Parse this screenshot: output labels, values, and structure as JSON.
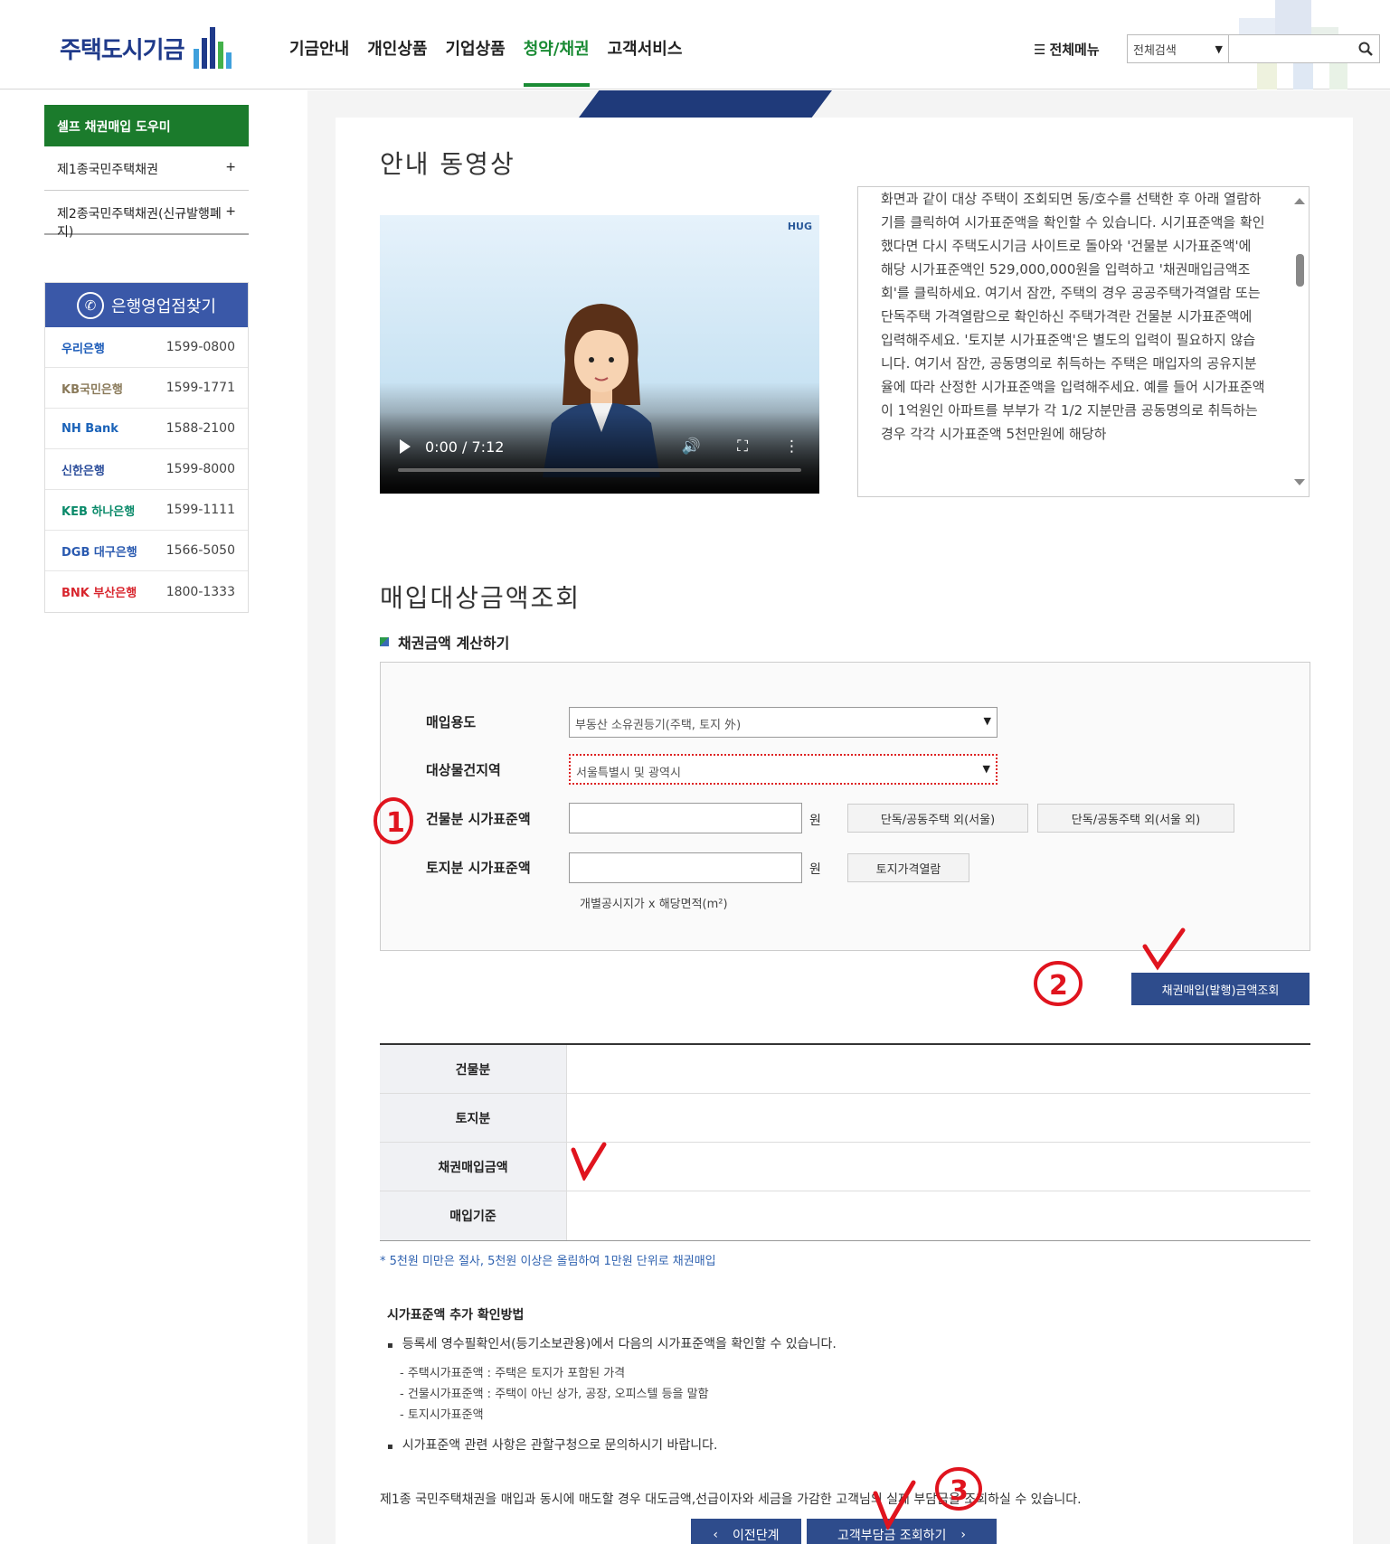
{
  "header": {
    "logo": "주택도시기금",
    "nav": [
      "기금안내",
      "개인상품",
      "기업상품",
      "청약/채권",
      "고객서비스"
    ],
    "active_nav": "청약/채권",
    "all_menu": "전체메뉴",
    "search_select": "전체검색"
  },
  "sidebar": {
    "active": "셀프 채권매입 도우미",
    "items": [
      "제1종국민주택채권",
      "제2종국민주택채권(신규발행폐지)"
    ],
    "plus": "+",
    "bank_header": "은행영업점찾기",
    "banks": [
      {
        "name": "우리은행",
        "phone": "1599-0800",
        "color": "#1a5ab8"
      },
      {
        "name": "KB국민은행",
        "phone": "1599-1771",
        "color": "#8a7a5a"
      },
      {
        "name": "NH Bank",
        "phone": "1588-2100",
        "color": "#1a62b8"
      },
      {
        "name": "신한은행",
        "phone": "1599-8000",
        "color": "#2a4c9a"
      },
      {
        "name": "KEB 하나은행",
        "phone": "1599-1111",
        "color": "#0a8a6a"
      },
      {
        "name": "DGB 대구은행",
        "phone": "1566-5050",
        "color": "#2a5ab0"
      },
      {
        "name": "BNK 부산은행",
        "phone": "1800-1333",
        "color": "#d8262e"
      }
    ]
  },
  "video_section": {
    "title": "안내 동영상",
    "video_logo": "HUG",
    "time": "0:00 / 7:12",
    "description": "화면과 같이 대상 주택이 조회되면 동/호수를 선택한 후 아래 열람하기를 클릭하여 시가표준액을 확인할 수 있습니다. 시기표준액을 확인했다면 다시 주택도시기금 사이트로 돌아와 '건물분 시가표준액'에 해당 시가표준액인 529,000,000원을 입력하고 '채권매입금액조회'를 클릭하세요. 여기서 잠깐, 주택의 경우 공공주택가격열람 또는 단독주택 가격열람으로 확인하신 주택가격란 건물분 시가표준액에 입력해주세요. '토지분 시가표준액'은 별도의 입력이 필요하지 않습니다. 여기서 잠깐, 공동명의로 취득하는 주택은 매입자의 공유지분율에 따라 산정한 시가표준액을 입력해주세요. 예를 들어 시가표준액이 1억원인 아파트를 부부가 각 1/2 지분만큼 공동명의로 취득하는 경우 각각 시가표준액 5천만원에 해당하"
  },
  "calc_section": {
    "title": "매입대상금액조회",
    "subtitle": "채권금액 계산하기",
    "labels": {
      "purpose": "매입용도",
      "region": "대상물건지역",
      "building": "건물분 시가표준액",
      "land": "토지분 시가표준액"
    },
    "purpose_value": "부동산 소유권등기(주택, 토지 外)",
    "region_value": "서울특별시 및 광역시",
    "unit": "원",
    "buttons": {
      "seoul": "단독/공동주택 외(서울)",
      "non_seoul": "단독/공동주택 외(서울 외)",
      "land_price": "토지가격열람"
    },
    "hint": "개별공시지가 x 해당면적(m²)",
    "query_button": "채권매입(발행)금액조회"
  },
  "result": {
    "rows": [
      "건물분",
      "토지분",
      "채권매입금액",
      "매입기준"
    ],
    "note": "* 5천원 미만은 절사, 5천원 이상은 올림하여 1만원 단위로 채권매입"
  },
  "info": {
    "title": "시가표준액 추가 확인방법",
    "item1": "등록세 영수필확인서(등기소보관용)에서 다음의 시가표준액을 확인할 수 있습니다.",
    "sub": [
      "- 주택시가표준액 : 주택은 토지가 포함된 가격",
      "- 건물시가표준액 : 주택이 아닌 상가, 공장, 오피스텔 등을 말함",
      "- 토지시가표준액"
    ],
    "item2": "시가표준액 관련 사항은 관할구청으로 문의하시기 바랍니다.",
    "bottom": "제1종 국민주택채권을 매입과 동시에 매도할 경우 대도금액,선급이자와 세금을 가감한 고객님의 실제 부담금을 조회하실 수 있습니다."
  },
  "footer_nav": {
    "prev": "이전단계",
    "next": "고객부담금 조회하기"
  },
  "annotations": [
    "1",
    "2",
    "3"
  ],
  "colors": {
    "brand_green": "#1a8b34",
    "navy": "#2e4c8c",
    "annot_red": "#e0141e"
  }
}
